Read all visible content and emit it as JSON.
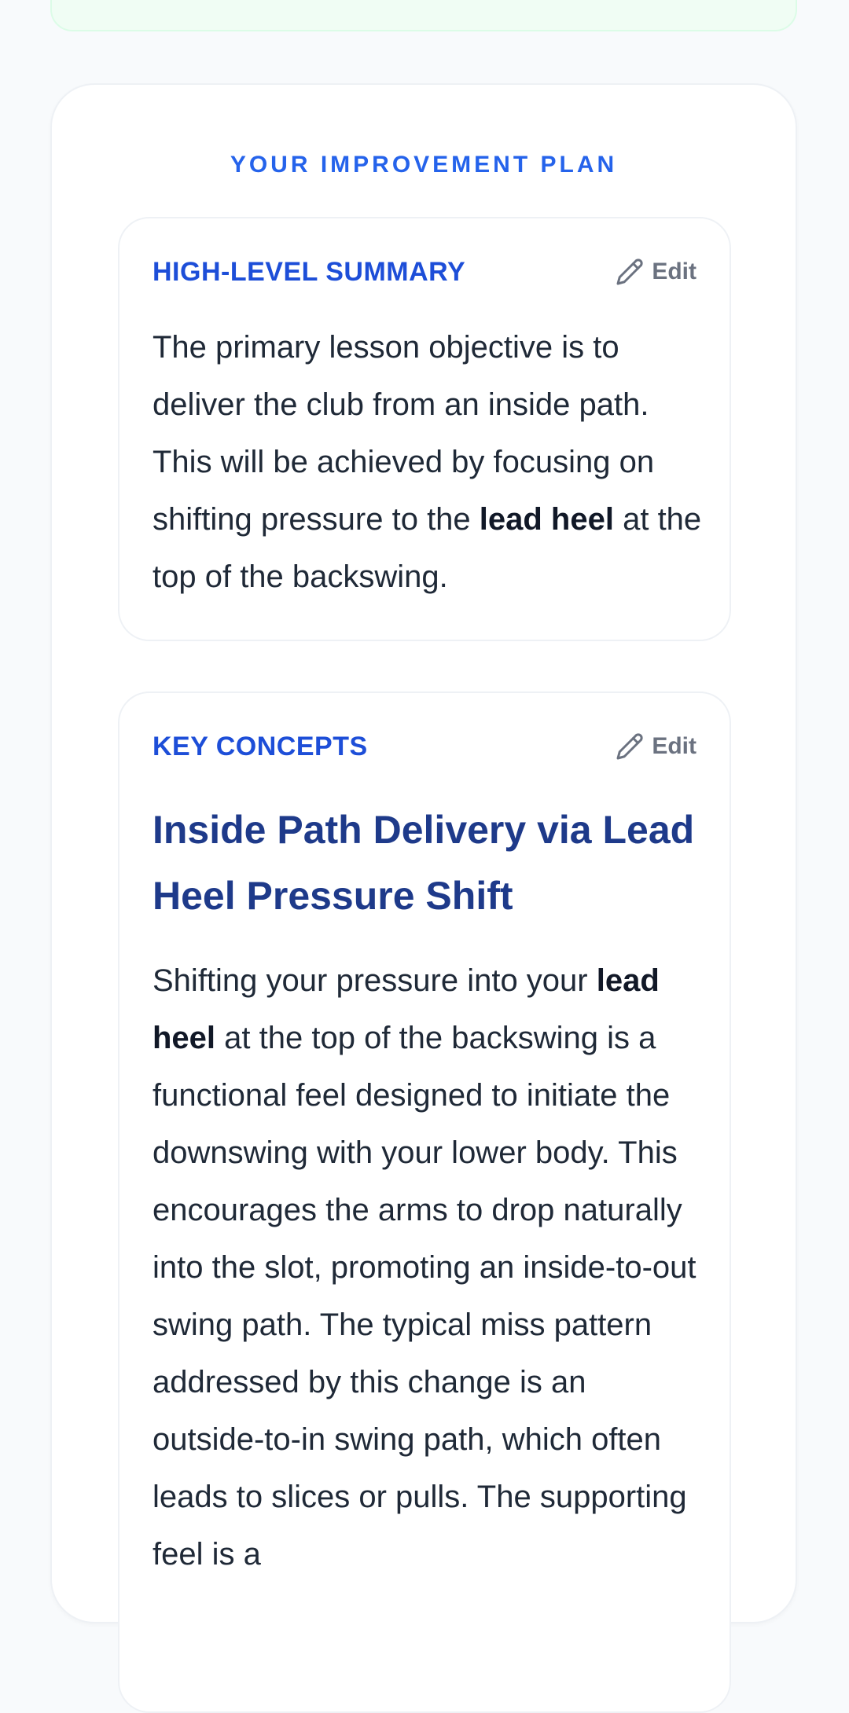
{
  "plan": {
    "title": "YOUR IMPROVEMENT PLAN"
  },
  "summary": {
    "label": "HIGH-LEVEL SUMMARY",
    "edit_label": "Edit",
    "text_1": "The primary lesson objective is to deliver the club from an inside path. This will be achieved by focusing on shifting pressure to the ",
    "text_bold": "lead heel",
    "text_2": " at the top of the backswing."
  },
  "concepts": {
    "label": "KEY CONCEPTS",
    "edit_label": "Edit",
    "title": "Inside Path Delivery via Lead Heel Pressure Shift",
    "text_1": "Shifting your pressure into your ",
    "text_bold": "lead heel",
    "text_2": " at the top of the backswing is a functional feel designed to initiate the downswing with your lower body. This encourages the arms to drop naturally into the slot, promoting an inside-to-out swing path. The typical miss pattern addressed by this change is an outside-to-in swing path, which often leads to slices or pulls. The supporting feel is a"
  },
  "icons": {
    "edit": "pencil-icon"
  },
  "colors": {
    "accent": "#2563eb",
    "section_label": "#1d4ed8",
    "concept_title": "#1e3a8a",
    "banner_bg": "#f0fdf4"
  }
}
